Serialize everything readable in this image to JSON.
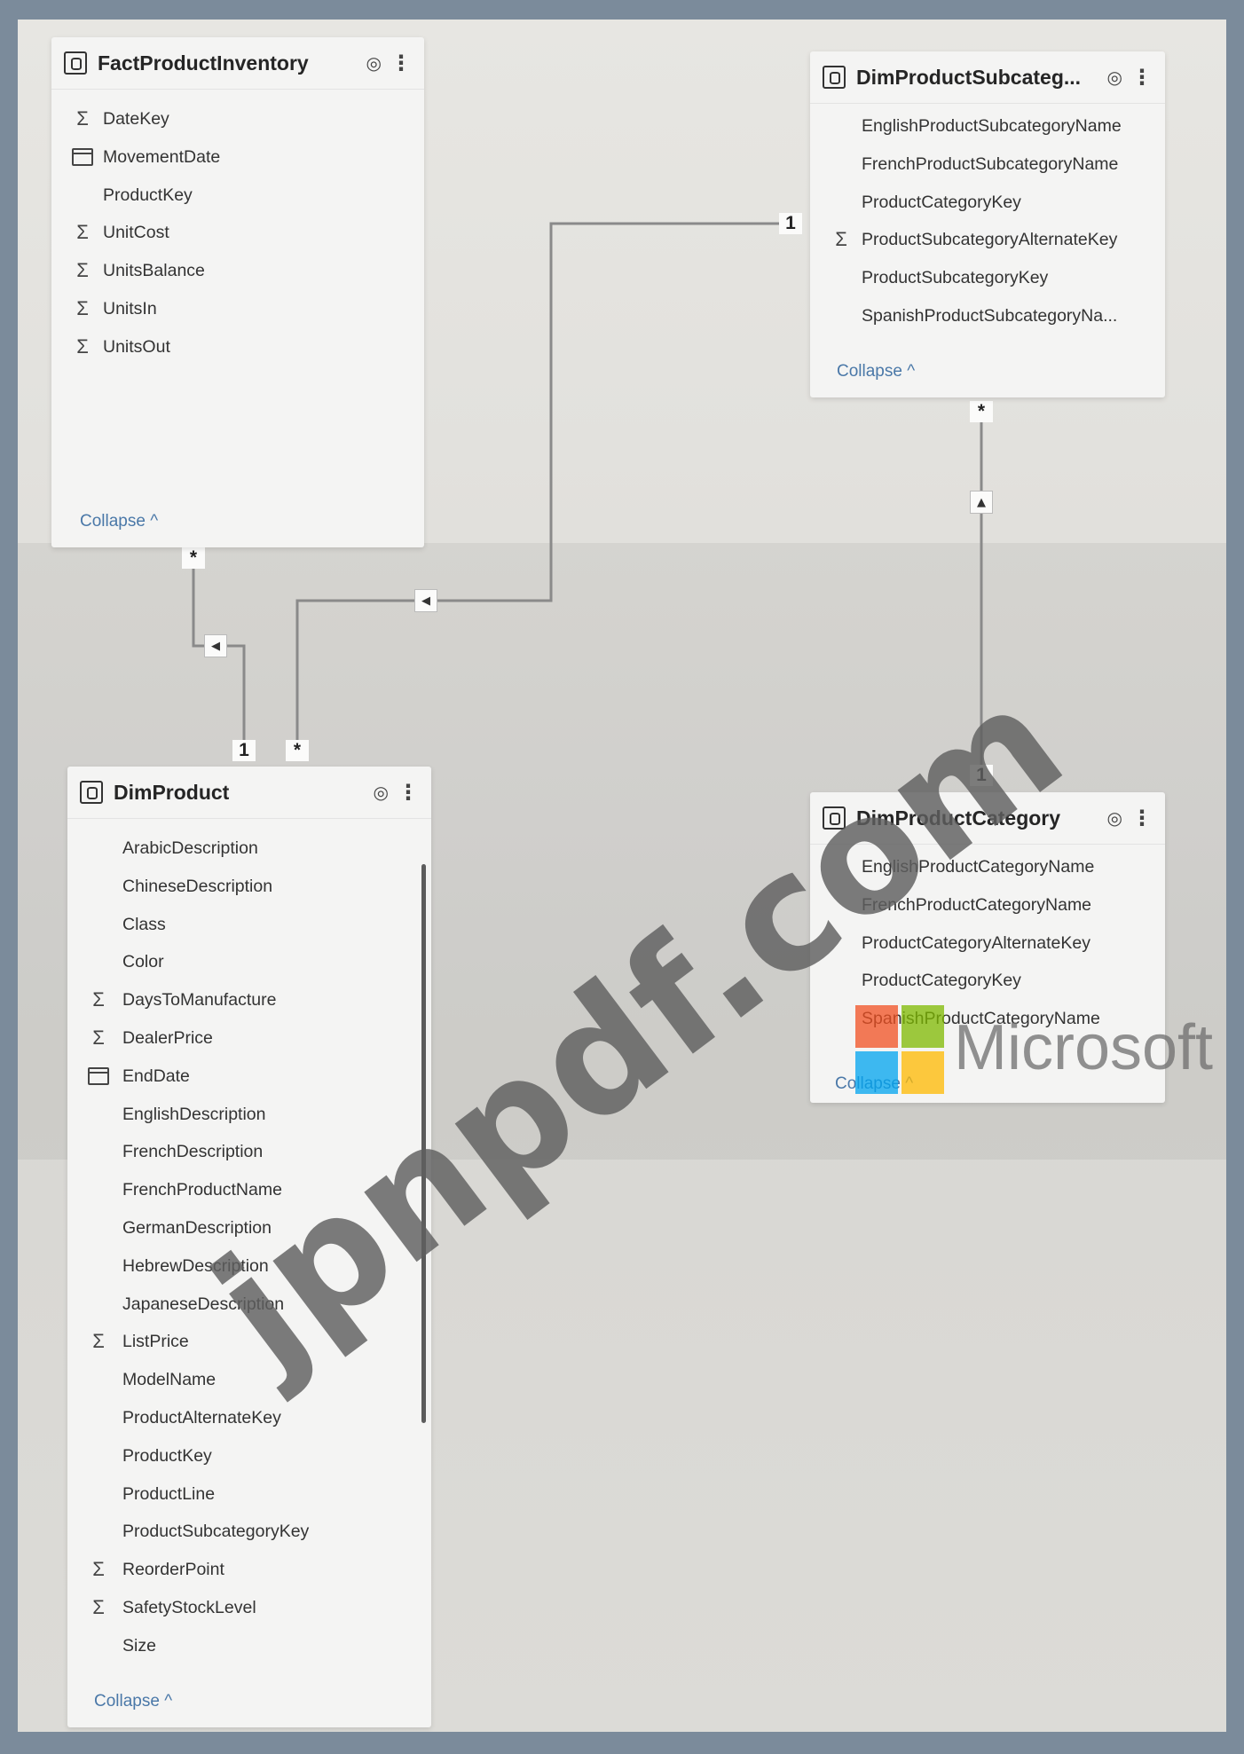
{
  "tables": [
    {
      "id": "fact_product_inventory",
      "title": "FactProductInventory",
      "fields": [
        {
          "name": "DateKey",
          "icon": "sigma-icon"
        },
        {
          "name": "MovementDate",
          "icon": "calendar-icon"
        },
        {
          "name": "ProductKey",
          "icon": ""
        },
        {
          "name": "UnitCost",
          "icon": "sigma-icon"
        },
        {
          "name": "UnitsBalance",
          "icon": "sigma-icon"
        },
        {
          "name": "UnitsIn",
          "icon": "sigma-icon"
        },
        {
          "name": "UnitsOut",
          "icon": "sigma-icon"
        }
      ],
      "collapse_label": "Collapse ^"
    },
    {
      "id": "dim_product_subcategory",
      "title": "DimProductSubcateg...",
      "fields": [
        {
          "name": "EnglishProductSubcategoryName",
          "icon": ""
        },
        {
          "name": "FrenchProductSubcategoryName",
          "icon": ""
        },
        {
          "name": "ProductCategoryKey",
          "icon": ""
        },
        {
          "name": "ProductSubcategoryAlternateKey",
          "icon": "sigma-icon"
        },
        {
          "name": "ProductSubcategoryKey",
          "icon": ""
        },
        {
          "name": "SpanishProductSubcategoryNa...",
          "icon": ""
        }
      ],
      "collapse_label": "Collapse ^"
    },
    {
      "id": "dim_product",
      "title": "DimProduct",
      "fields": [
        {
          "name": "ArabicDescription",
          "icon": ""
        },
        {
          "name": "ChineseDescription",
          "icon": ""
        },
        {
          "name": "Class",
          "icon": ""
        },
        {
          "name": "Color",
          "icon": ""
        },
        {
          "name": "DaysToManufacture",
          "icon": "sigma-icon"
        },
        {
          "name": "DealerPrice",
          "icon": "sigma-icon"
        },
        {
          "name": "EndDate",
          "icon": "calendar-icon"
        },
        {
          "name": "EnglishDescription",
          "icon": ""
        },
        {
          "name": "FrenchDescription",
          "icon": ""
        },
        {
          "name": "FrenchProductName",
          "icon": ""
        },
        {
          "name": "GermanDescription",
          "icon": ""
        },
        {
          "name": "HebrewDescription",
          "icon": ""
        },
        {
          "name": "JapaneseDescription",
          "icon": ""
        },
        {
          "name": "ListPrice",
          "icon": "sigma-icon"
        },
        {
          "name": "ModelName",
          "icon": ""
        },
        {
          "name": "ProductAlternateKey",
          "icon": ""
        },
        {
          "name": "ProductKey",
          "icon": ""
        },
        {
          "name": "ProductLine",
          "icon": ""
        },
        {
          "name": "ProductSubcategoryKey",
          "icon": ""
        },
        {
          "name": "ReorderPoint",
          "icon": "sigma-icon"
        },
        {
          "name": "SafetyStockLevel",
          "icon": "sigma-icon"
        },
        {
          "name": "Size",
          "icon": ""
        }
      ],
      "collapse_label": "Collapse ^"
    },
    {
      "id": "dim_product_category",
      "title": "DimProductCategory",
      "fields": [
        {
          "name": "EnglishProductCategoryName",
          "icon": ""
        },
        {
          "name": "FrenchProductCategoryName",
          "icon": ""
        },
        {
          "name": "ProductCategoryAlternateKey",
          "icon": ""
        },
        {
          "name": "ProductCategoryKey",
          "icon": ""
        },
        {
          "name": "SpanishProductCategoryName",
          "icon": ""
        }
      ],
      "collapse_label": "Collapse ^"
    }
  ],
  "relationships": [
    {
      "from": "FactProductInventory",
      "to": "DimProduct",
      "from_cardinality": "*",
      "to_cardinality": "1"
    },
    {
      "from": "DimProduct",
      "to": "DimProductSubcategory",
      "from_cardinality": "*",
      "to_cardinality": "1"
    },
    {
      "from": "DimProductSubcategory",
      "to": "DimProductCategory",
      "from_cardinality": "*",
      "to_cardinality": "1"
    }
  ],
  "icons": {
    "eye": "eye-icon",
    "more": "more-options-icon",
    "table": "table-icon"
  },
  "watermark_text": "jpnpdf.com",
  "microsoft_logo_text": "Microsoft",
  "colors": {
    "link": "#4a78a8",
    "ms_red": "#f25022",
    "ms_green": "#7fba00",
    "ms_blue": "#00a4ef",
    "ms_yellow": "#ffb900"
  }
}
